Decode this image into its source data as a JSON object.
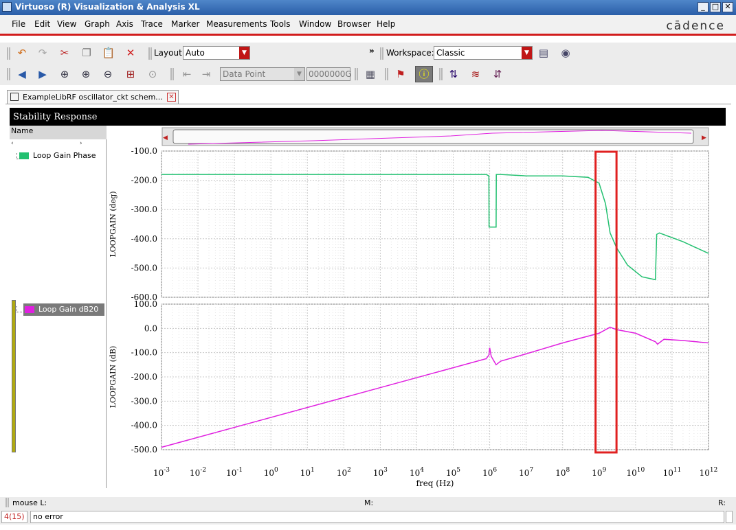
{
  "window": {
    "title": "Virtuoso (R) Visualization & Analysis XL",
    "minimize": "_",
    "maximize": "□",
    "close": "✕"
  },
  "menu": {
    "items": [
      "File",
      "Edit",
      "View",
      "Graph",
      "Axis",
      "Trace",
      "Marker",
      "Measurements",
      "Tools",
      "Window",
      "Browser",
      "Help"
    ],
    "brand": "cādence"
  },
  "toolbar1": {
    "layout_label": "Layout:",
    "layout_value": "Auto",
    "overflow": "»",
    "workspace_label": "Workspace:",
    "workspace_value": "Classic"
  },
  "toolbar2": {
    "marker_mode": "Data Point",
    "marker_value": "0000000G"
  },
  "tab": {
    "label": "ExampleLibRF oscillator_ckt schem...",
    "close": "✕"
  },
  "panel": {
    "title": "Stability Response",
    "name_column": "Name",
    "traces": [
      {
        "label": "Loop Gain Phase",
        "color": "#22c070"
      },
      {
        "label": "Loop Gain dB20",
        "color": "#e020e0"
      }
    ]
  },
  "status": {
    "mouse_left": "mouse L:",
    "mouse_mid": "M:",
    "mouse_right": "R:",
    "counter": "4(15)",
    "message": "no error"
  },
  "colors": {
    "accent_red": "#d21c1c",
    "phase_trace": "#22c070",
    "gain_trace": "#e020e0",
    "highlight_box": "#e02020"
  },
  "chart_data": [
    {
      "type": "line",
      "title": "",
      "xlabel": "freq (Hz)",
      "ylabel": "LOOPGAIN (deg)",
      "xscale": "log",
      "xlim": [
        0.001,
        1000000000000
      ],
      "ylim": [
        -600,
        -100
      ],
      "yticks": [
        "-100.0",
        "-200.0",
        "-300.0",
        "-400.0",
        "-500.0",
        "-600.0"
      ],
      "grid": true,
      "series": [
        {
          "name": "Loop Gain Phase",
          "color": "#22c070",
          "x": [
            0.001,
            800000,
            950000,
            960000,
            1500000,
            1520000,
            2000000,
            10000000,
            100000000,
            500000000,
            1000000000,
            1500000000,
            2000000000,
            3000000000,
            6000000000,
            15000000000,
            35000000000,
            38000000000,
            45000000000,
            200000000000,
            1000000000000
          ],
          "y": [
            -180,
            -180,
            -185,
            -360,
            -360,
            -180,
            -180,
            -185,
            -185,
            -190,
            -210,
            -280,
            -380,
            -430,
            -490,
            -530,
            -540,
            -385,
            -380,
            -410,
            -450
          ]
        }
      ]
    },
    {
      "type": "line",
      "title": "",
      "xlabel": "freq (Hz)",
      "ylabel": "LOOPGAIN (dB)",
      "xscale": "log",
      "xlim": [
        0.001,
        1000000000000
      ],
      "ylim": [
        -500,
        100
      ],
      "yticks": [
        "100.0",
        "0.0",
        "-100.0",
        "-200.0",
        "-300.0",
        "-400.0",
        "-500.0"
      ],
      "xticks": [
        "10-3",
        "10-2",
        "10-1",
        "100",
        "101",
        "102",
        "103",
        "104",
        "105",
        "106",
        "107",
        "108",
        "109",
        "1010",
        "1011",
        "1012"
      ],
      "grid": true,
      "series": [
        {
          "name": "Loop Gain dB20",
          "color": "#e020e0",
          "x": [
            0.001,
            800000,
            950000,
            1000000,
            1100000,
            1500000,
            2000000,
            10000000,
            100000000,
            1000000000,
            2000000000,
            3000000000,
            10000000000,
            35000000000,
            40000000000,
            60000000000,
            200000000000,
            1000000000000
          ],
          "y": [
            -490,
            -125,
            -110,
            -80,
            -115,
            -150,
            -135,
            -105,
            -60,
            -20,
            5,
            -5,
            -20,
            -55,
            -65,
            -45,
            -50,
            -60
          ]
        }
      ],
      "annotations": [
        {
          "type": "highlight-box",
          "color": "#e02020",
          "x_range": [
            800000000,
            3000000000
          ]
        }
      ]
    }
  ]
}
